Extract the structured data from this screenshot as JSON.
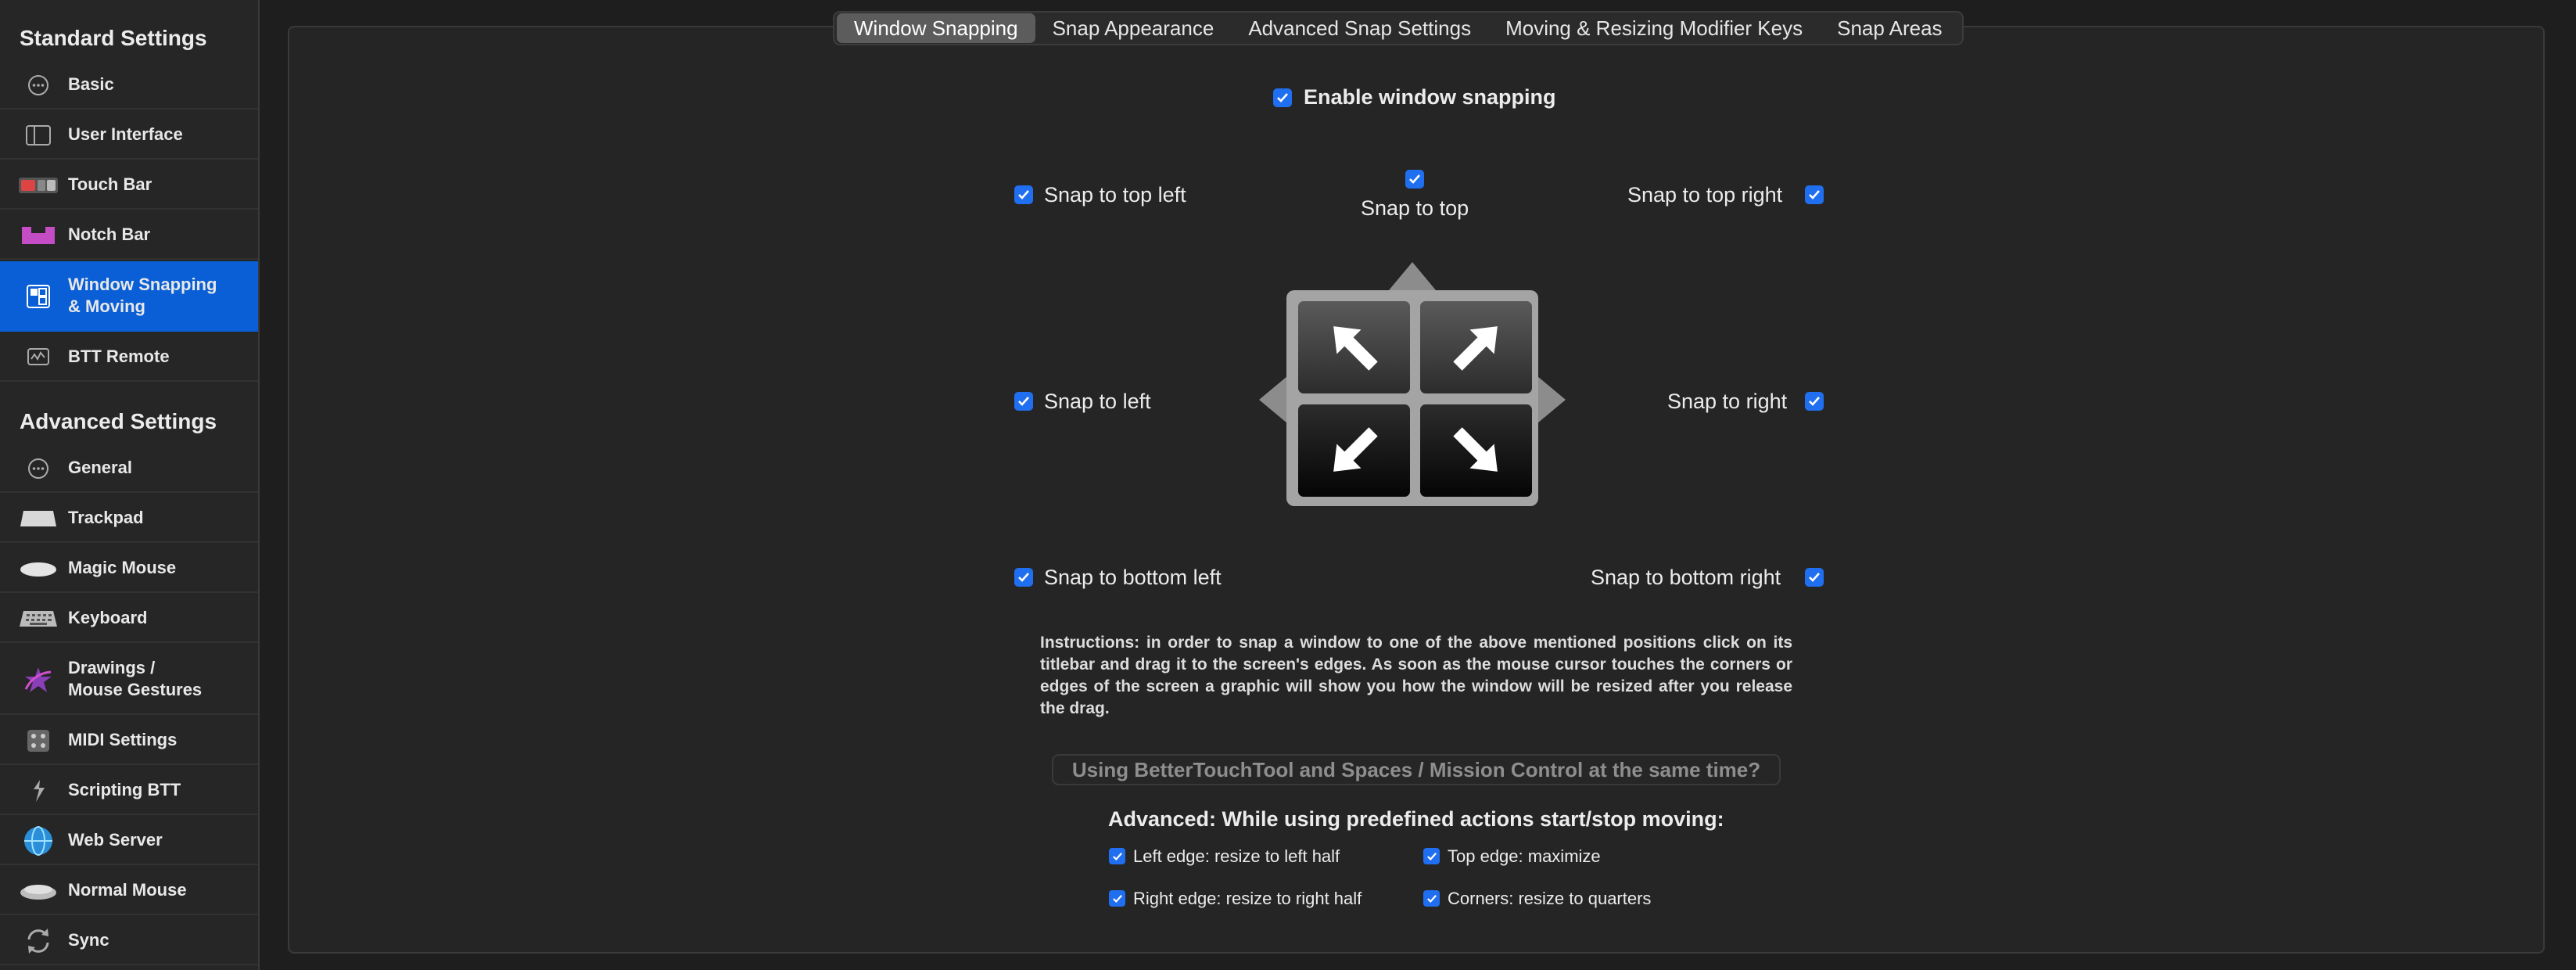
{
  "sidebar": {
    "standard_title": "Standard Settings",
    "advanced_title": "Advanced Settings",
    "standard_items": [
      {
        "label": "Basic",
        "icon": "ellipsis-circle-icon"
      },
      {
        "label": "User Interface",
        "icon": "sidebar-icon"
      },
      {
        "label": "Touch Bar",
        "icon": "touch-bar-icon"
      },
      {
        "label": "Notch Bar",
        "icon": "notch-bar-icon"
      },
      {
        "label": "Window Snapping\n& Moving",
        "icon": "window-snapping-icon"
      },
      {
        "label": "BTT Remote",
        "icon": "remote-icon"
      }
    ],
    "advanced_items": [
      {
        "label": "General",
        "icon": "ellipsis-circle-icon"
      },
      {
        "label": "Trackpad",
        "icon": "trackpad-icon"
      },
      {
        "label": "Magic Mouse",
        "icon": "magic-mouse-icon"
      },
      {
        "label": "Keyboard",
        "icon": "keyboard-icon"
      },
      {
        "label": "Drawings /\nMouse Gestures",
        "icon": "drawing-star-icon"
      },
      {
        "label": "MIDI Settings",
        "icon": "midi-icon"
      },
      {
        "label": "Scripting BTT",
        "icon": "script-icon"
      },
      {
        "label": "Web Server",
        "icon": "globe-icon"
      },
      {
        "label": "Normal Mouse",
        "icon": "mouse-icon"
      },
      {
        "label": "Sync",
        "icon": "sync-icon"
      }
    ],
    "active_color": "#0a5fd6"
  },
  "tabs": [
    "Window Snapping",
    "Snap Appearance",
    "Advanced Snap Settings",
    "Moving & Resizing Modifier Keys",
    "Snap Areas"
  ],
  "active_tab": "Window Snapping",
  "snapping": {
    "enable_label": "Enable window snapping",
    "top_left": "Snap to top left",
    "top": "Snap to top",
    "top_right": "Snap to top right",
    "left": "Snap to left",
    "right": "Snap to right",
    "bottom_left": "Snap to bottom left",
    "bottom_right": "Snap to bottom right"
  },
  "instructions": "Instructions: in order to snap a window to one of the above mentioned positions click on its titlebar and drag it to the screen's edges. As soon as the mouse cursor touches the corners or edges of the screen a graphic will show you how the window will be resized after you release the drag.",
  "spaces_button": "Using BetterTouchTool and Spaces / Mission Control at the same time?",
  "advanced": {
    "title": "Advanced: While using predefined actions start/stop moving:",
    "left_edge": "Left edge: resize to left half",
    "top_edge": "Top edge: maximize",
    "right_edge": "Right edge: resize to right half",
    "corners": "Corners: resize to quarters"
  },
  "checkbox_color": "#1f6ff0"
}
